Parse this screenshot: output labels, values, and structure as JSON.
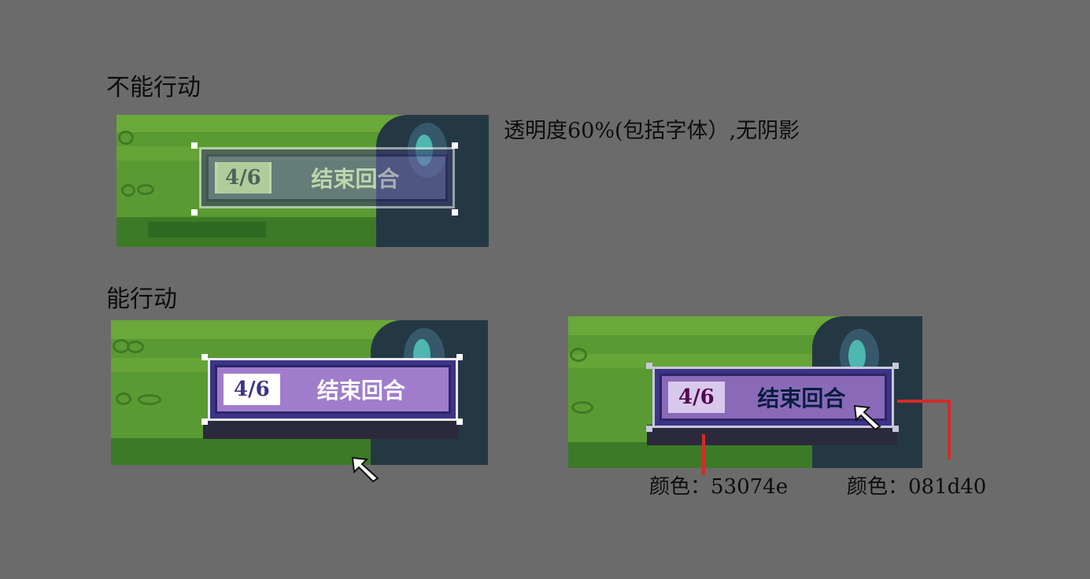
{
  "sections": {
    "disabled_title": "不能行动",
    "enabled_title": "能行动",
    "disabled_note": "透明度60%(包括字体）,无阴影"
  },
  "hud": {
    "counter": "4/6",
    "end_turn": "结束回合"
  },
  "colors": {
    "counter_text_label": "颜色：53074e",
    "border_label": "颜色：081d40",
    "counter_text_hex": "#53074e",
    "border_hex": "#081d40",
    "grass": "#5a9a32",
    "hud_purple": "#a07ccc",
    "hud_frame": "#3d3487"
  }
}
